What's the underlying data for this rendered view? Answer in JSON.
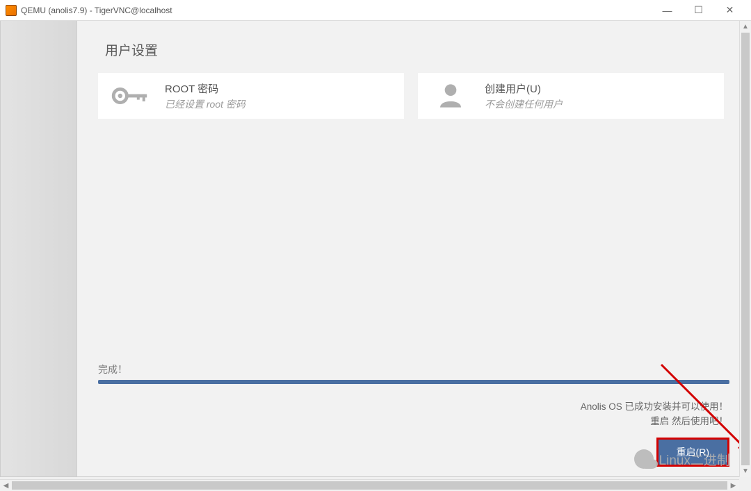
{
  "window": {
    "title": "QEMU (anolis7.9) - TigerVNC@localhost"
  },
  "installer": {
    "section_title": "用户设置",
    "cards": [
      {
        "title": "ROOT 密码",
        "subtitle": "已经设置 root 密码"
      },
      {
        "title": "创建用户(U)",
        "subtitle": "不会创建任何用户"
      }
    ],
    "complete_label": "完成！",
    "success_line1": "Anolis OS 已成功安装并可以使用！",
    "success_line2": "重启 然后使用吧！",
    "reboot_button": "重启(R)"
  },
  "watermark": {
    "text": "Linux二进制"
  }
}
